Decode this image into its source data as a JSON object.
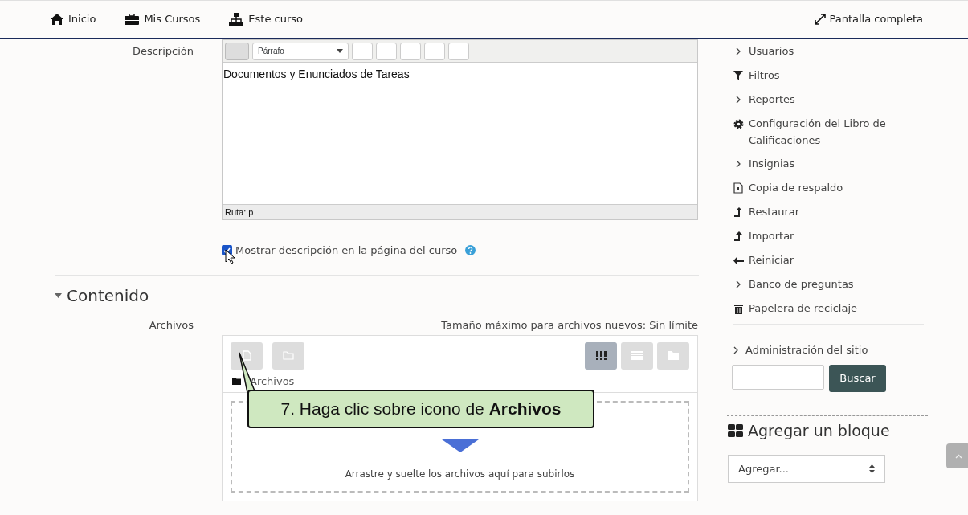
{
  "nav": {
    "items": [
      {
        "label": "Inicio"
      },
      {
        "label": "Mis Cursos"
      },
      {
        "label": "Este curso"
      }
    ],
    "fullscreen": "Pantalla completa"
  },
  "form": {
    "description_label": "Descripción",
    "editor": {
      "format": "Párrafo",
      "content": "Documentos y Enunciados de Tareas",
      "path": "Ruta: p"
    },
    "show_description": {
      "label": "Mostrar descripción en la página del curso",
      "checked": true
    },
    "section": {
      "title": "Contenido",
      "expanded": true
    },
    "files": {
      "label": "Archivos",
      "max_size": "Tamaño máximo para archivos nuevos: Sin límite",
      "views": [
        {
          "selected": true
        },
        {
          "selected": false
        },
        {
          "selected": false
        }
      ],
      "breadcrumb": "Archivos",
      "drop_hint": "Arrastre y suelte los archivos aquí para subirlos"
    }
  },
  "callout": "7. Haga clic sobre icono de **Archivos**",
  "sidebar": {
    "items": [
      {
        "label": "Usuarios",
        "kind": "chevron"
      },
      {
        "label": "Filtros",
        "kind": "filter"
      },
      {
        "label": "Reportes",
        "kind": "chevron"
      },
      {
        "label": "Configuración del Libro de Calificaciones",
        "kind": "gear"
      },
      {
        "label": "Insignias",
        "kind": "chevron"
      },
      {
        "label": "Copia de respaldo",
        "kind": "file"
      },
      {
        "label": "Restaurar",
        "kind": "upload"
      },
      {
        "label": "Importar",
        "kind": "upload"
      },
      {
        "label": "Reiniciar",
        "kind": "back"
      },
      {
        "label": "Banco de preguntas",
        "kind": "chevron"
      },
      {
        "label": "Papelera de reciclaje",
        "kind": "trash"
      }
    ],
    "site_admin": "Administración del sitio",
    "search_button": "Buscar",
    "add_block": {
      "title": "Agregar un bloque",
      "select": "Agregar..."
    }
  }
}
